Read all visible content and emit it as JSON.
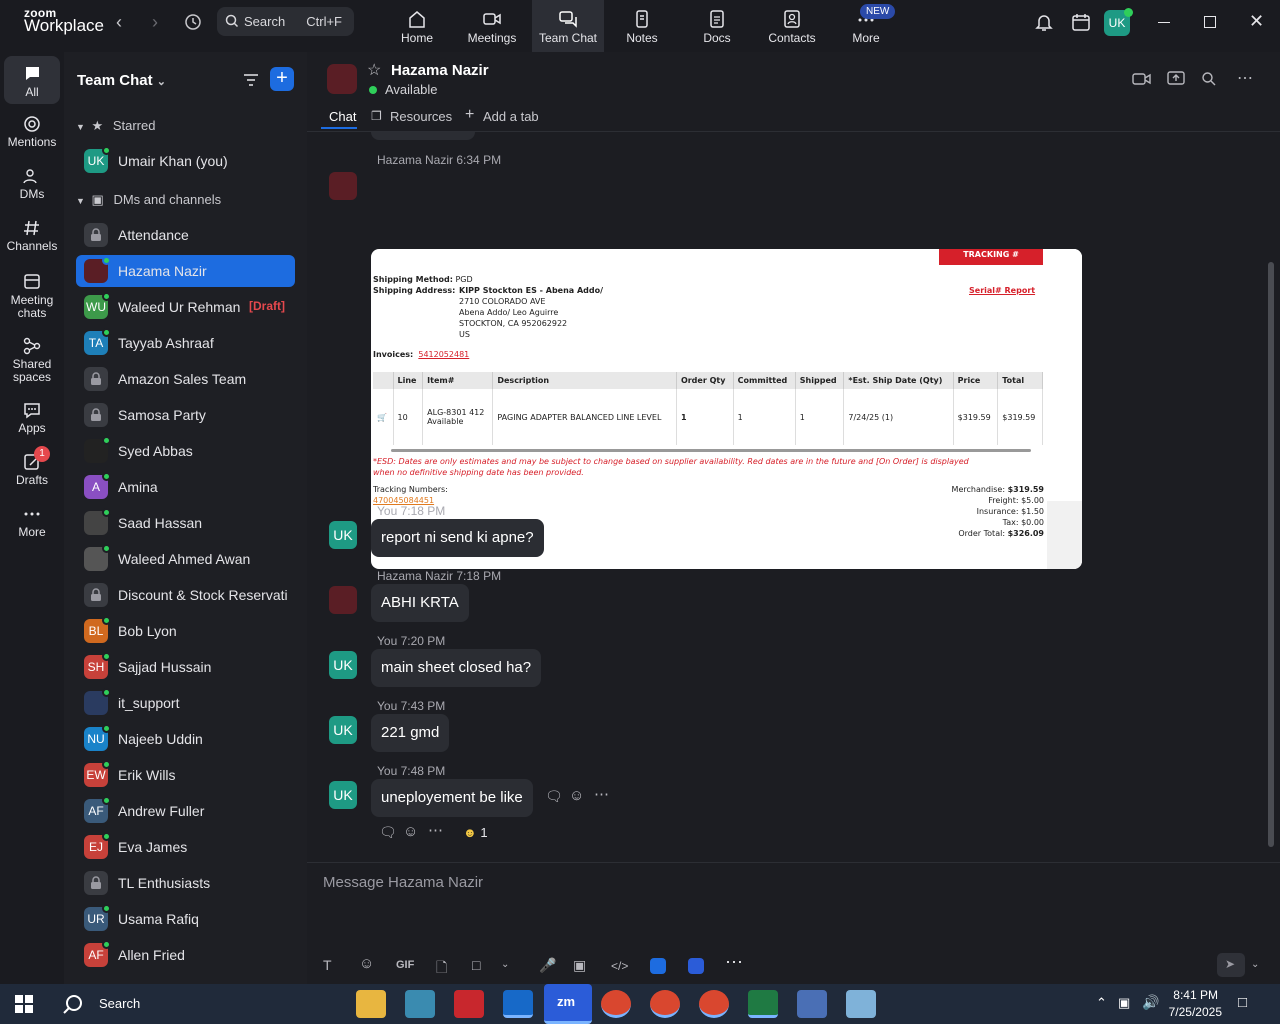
{
  "app": {
    "logo_top": "zoom",
    "logo_bottom": "Workplace"
  },
  "search": {
    "label": "Search",
    "shortcut": "Ctrl+F"
  },
  "top_tabs": [
    {
      "label": "Home",
      "icon": "home-icon"
    },
    {
      "label": "Meetings",
      "icon": "video-icon"
    },
    {
      "label": "Team Chat",
      "icon": "chat-icon"
    },
    {
      "label": "Notes",
      "icon": "notes-icon"
    },
    {
      "label": "Docs",
      "icon": "docs-icon"
    },
    {
      "label": "Contacts",
      "icon": "contacts-icon"
    },
    {
      "label": "More",
      "icon": "more-icon"
    }
  ],
  "new_badge": "NEW",
  "user_avatar": "UK",
  "rail": [
    {
      "label": "All"
    },
    {
      "label": "Mentions"
    },
    {
      "label": "DMs"
    },
    {
      "label": "Channels"
    },
    {
      "label": "Meeting chats"
    },
    {
      "label": "Shared spaces"
    },
    {
      "label": "Apps"
    },
    {
      "label": "Drafts",
      "badge": "1"
    },
    {
      "label": "More"
    }
  ],
  "sidebar": {
    "title": "Team Chat",
    "starred_label": "Starred",
    "dms_label": "DMs and channels",
    "starred": [
      {
        "initials": "UK",
        "name": "Umair Khan (you)",
        "color": "#1e9a84"
      }
    ],
    "items": [
      {
        "initials": "",
        "name": "Attendance",
        "color": "#3a3c42",
        "lock": true
      },
      {
        "initials": "",
        "name": "Hazama Nazir",
        "color": "#5a1e25",
        "active": true
      },
      {
        "initials": "WU",
        "name": "Waleed Ur Rehman",
        "color": "#3d9a4a",
        "draft": "[Draft]"
      },
      {
        "initials": "TA",
        "name": "Tayyab Ashraaf",
        "color": "#1e7fb8"
      },
      {
        "initials": "",
        "name": "Amazon Sales Team",
        "color": "#3a3c42",
        "lock": true
      },
      {
        "initials": "",
        "name": "Samosa Party",
        "color": "#3a3c42",
        "lock": true
      },
      {
        "initials": "",
        "name": "Syed Abbas",
        "color": "#222"
      },
      {
        "initials": "A",
        "name": "Amina",
        "color": "#8a4fc2"
      },
      {
        "initials": "",
        "name": "Saad Hassan",
        "color": "#444"
      },
      {
        "initials": "",
        "name": "Waleed Ahmed Awan",
        "color": "#555"
      },
      {
        "initials": "",
        "name": "Discount & Stock Reservati...",
        "color": "#3a3c42",
        "lock": true
      },
      {
        "initials": "BL",
        "name": "Bob Lyon",
        "color": "#d0691f"
      },
      {
        "initials": "SH",
        "name": "Sajjad Hussain",
        "color": "#c7413a"
      },
      {
        "initials": "",
        "name": "it_support",
        "color": "#2a3b60"
      },
      {
        "initials": "NU",
        "name": "Najeeb Uddin",
        "color": "#1a83c9"
      },
      {
        "initials": "EW",
        "name": "Erik Wills",
        "color": "#c7413a"
      },
      {
        "initials": "AF",
        "name": "Andrew Fuller",
        "color": "#3a5a7a"
      },
      {
        "initials": "EJ",
        "name": "Eva James",
        "color": "#c7413a"
      },
      {
        "initials": "",
        "name": "TL Enthusiasts",
        "color": "#3a3c42",
        "lock": true
      },
      {
        "initials": "UR",
        "name": "Usama Rafiq",
        "color": "#3a5a7a"
      },
      {
        "initials": "AF",
        "name": "Allen Fried",
        "color": "#c7413a"
      }
    ]
  },
  "chat_header": {
    "name": "Hazama Nazir",
    "status": "Available"
  },
  "chat_tabs": {
    "chat": "Chat",
    "resources": "Resources",
    "add": "Add a tab"
  },
  "messages": [
    {
      "author": "Hazama Nazir",
      "time": "6:34 PM"
    },
    {
      "author": "You",
      "time": "7:18 PM",
      "text": "report ni send ki apne?"
    },
    {
      "author": "Hazama Nazir",
      "time": "7:18 PM",
      "text": "ABHI KRTA"
    },
    {
      "author": "You",
      "time": "7:20 PM",
      "text": "main sheet closed ha?"
    },
    {
      "author": "You",
      "time": "7:43 PM",
      "text": "221 gmd"
    },
    {
      "author": "You",
      "time": "7:48 PM",
      "text": "uneployement be like"
    }
  ],
  "reaction_count": "1",
  "attachment": {
    "tracking_btn": "TRACKING #",
    "shipping_method_label": "Shipping Method:",
    "shipping_method": "PGD",
    "shipping_address_label": "Shipping Address:",
    "address_1": "KIPP Stockton ES - Abena Addo/",
    "address_2": "2710 COLORADO AVE",
    "address_3": "Abena Addo/ Leo Aguirre",
    "address_4": "STOCKTON, CA 952062922",
    "address_5": "US",
    "serial_report": "Serial# Report",
    "invoices_label": "Invoices:",
    "invoice": "5412052481",
    "columns": [
      "Line",
      "Item#",
      "Description",
      "Order Qty",
      "Committed",
      "Shipped",
      "*Est. Ship Date (Qty)",
      "Price",
      "Total"
    ],
    "row": {
      "line": "10",
      "item": "ALG-8301 412",
      "avail": "Available",
      "desc": "PAGING ADAPTER BALANCED LINE LEVEL",
      "order_qty": "1",
      "committed": "1",
      "shipped": "1",
      "ship_date": "7/24/25 (1)",
      "price": "$319.59",
      "total": "$319.59"
    },
    "esd_note_1": "*ESD: Dates are only estimates and may be subject to change based on supplier availability. Red dates are in the future and [On Order] is displayed",
    "esd_note_2": "when no definitive shipping date has been provided.",
    "tracking_label": "Tracking Numbers:",
    "tracking_number": "470045084451",
    "merch_label": "Merchandise:",
    "merch": "$319.59",
    "freight_label": "Freight:",
    "freight": "$5.00",
    "insurance_label": "Insurance:",
    "insurance": "$1.50",
    "tax_label": "Tax:",
    "tax": "$0.00",
    "total_label": "Order Total:",
    "total": "$326.09"
  },
  "composer": {
    "placeholder": "Message Hazama Nazir",
    "gif": "GIF"
  },
  "taskbar": {
    "search": "Search",
    "time": "8:41 PM",
    "date": "7/25/2025"
  }
}
